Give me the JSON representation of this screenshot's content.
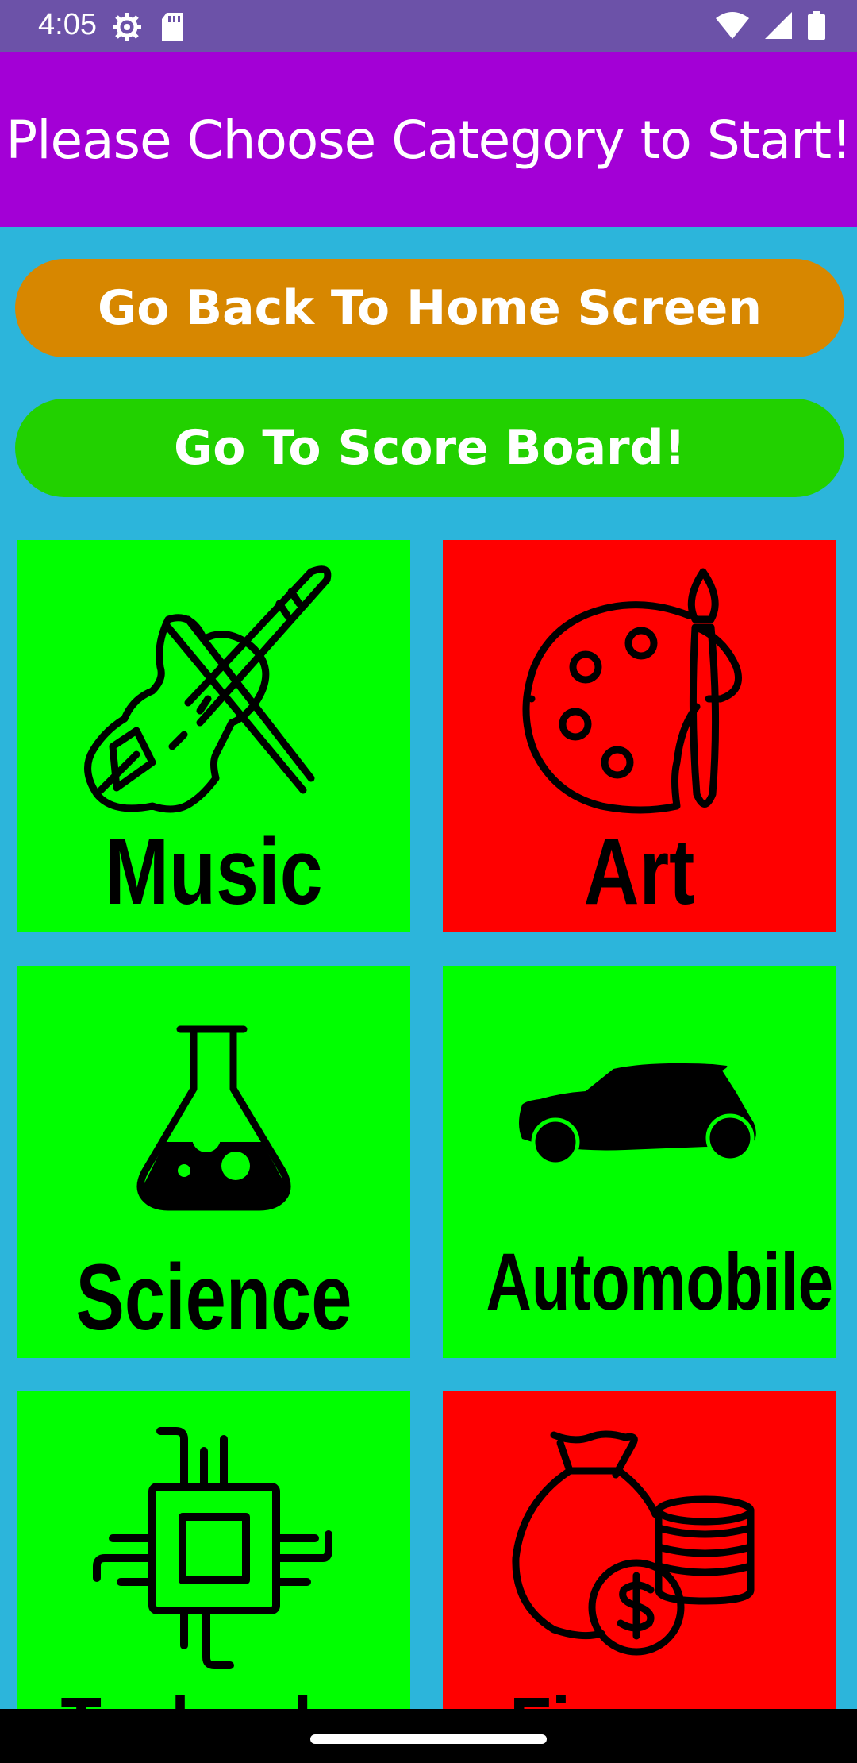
{
  "status_bar": {
    "time": "4:05",
    "left_icons": [
      "settings-gear-icon",
      "sd-card-icon"
    ],
    "right_icons": [
      "wifi-icon",
      "cellular-signal-icon",
      "battery-icon"
    ],
    "background": "#6C52A8"
  },
  "header": {
    "title": "Please Choose Category to Start!",
    "background": "#A300D6"
  },
  "actions": {
    "home_label": "Go Back To Home Screen",
    "home_color": "#D78700",
    "score_label": "Go To Score Board!",
    "score_color": "#22D100"
  },
  "categories": [
    {
      "label": "Music",
      "icon": "violin-icon",
      "color": "#00FF00"
    },
    {
      "label": "Art",
      "icon": "palette-icon",
      "color": "#FF0000"
    },
    {
      "label": "Science",
      "icon": "flask-icon",
      "color": "#00FF00"
    },
    {
      "label": "Automobile",
      "icon": "car-icon",
      "color": "#00FF00"
    },
    {
      "label": "Technology",
      "icon": "chip-icon",
      "color": "#00FF00"
    },
    {
      "label": "Finance",
      "icon": "money-bag-icon",
      "color": "#FF0000"
    }
  ],
  "page_background": "#2CB5DB"
}
